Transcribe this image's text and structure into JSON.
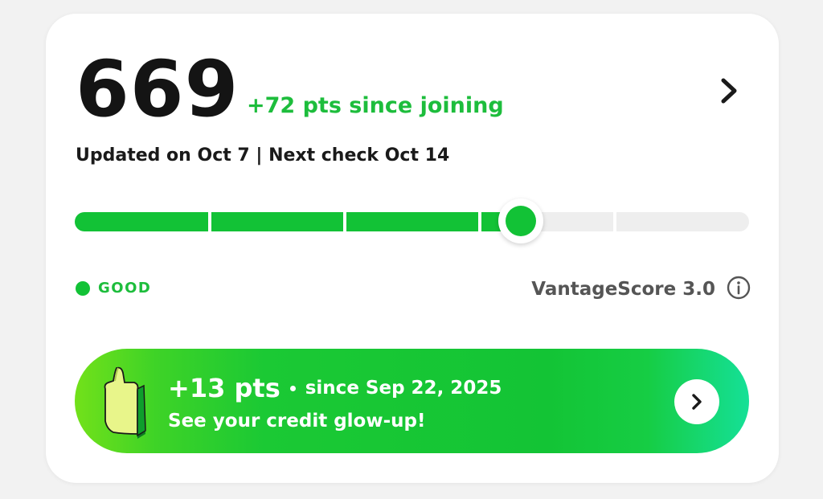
{
  "score": {
    "value": "669",
    "delta": "+72 pts since joining",
    "updated": "Updated on Oct 7 | Next check Oct 14"
  },
  "meter": {
    "level": 0.66
  },
  "rating": {
    "label": "GOOD",
    "color": "#12c236"
  },
  "model": {
    "label": "VantageScore 3.0",
    "info_icon": "info-icon"
  },
  "banner": {
    "points": "+13 pts",
    "since": "since Sep 22, 2025",
    "cta": "See your credit glow-up!",
    "icon": "thumbs-up-icon",
    "arrow_icon": "chevron-right-icon"
  },
  "colors": {
    "accent": "#12c236",
    "accent_text": "#1dbd3c",
    "track_off": "#eeeeee"
  }
}
